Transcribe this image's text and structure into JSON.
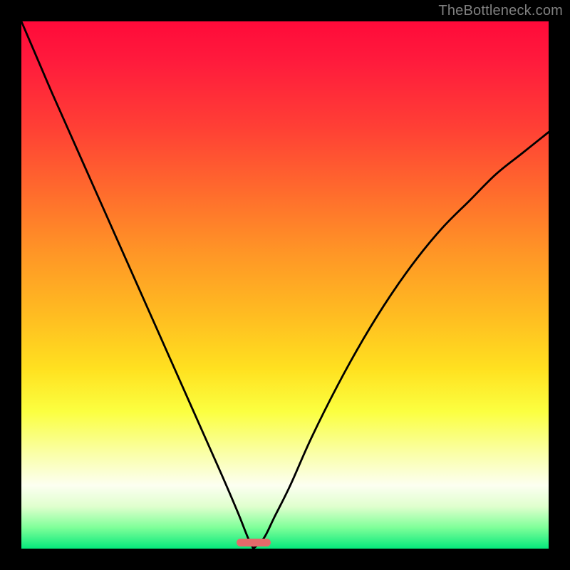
{
  "watermark": "TheBottleneck.com",
  "plot": {
    "background_gradient": {
      "stops": [
        {
          "pos": 0.0,
          "color": "#ff0a3a"
        },
        {
          "pos": 0.08,
          "color": "#ff1c3c"
        },
        {
          "pos": 0.2,
          "color": "#ff3f35"
        },
        {
          "pos": 0.32,
          "color": "#ff6a2d"
        },
        {
          "pos": 0.44,
          "color": "#ff9626"
        },
        {
          "pos": 0.56,
          "color": "#ffbd21"
        },
        {
          "pos": 0.66,
          "color": "#ffe120"
        },
        {
          "pos": 0.74,
          "color": "#fbff40"
        },
        {
          "pos": 0.82,
          "color": "#faffa8"
        },
        {
          "pos": 0.88,
          "color": "#fcfff1"
        },
        {
          "pos": 0.92,
          "color": "#e0ffce"
        },
        {
          "pos": 0.96,
          "color": "#7fff99"
        },
        {
          "pos": 1.0,
          "color": "#06e87c"
        }
      ]
    },
    "marker": {
      "x_fraction": 0.44,
      "y_fraction": 0.988,
      "width_fraction": 0.065,
      "color": "#e46a6a"
    }
  },
  "chart_data": {
    "type": "line",
    "title": "",
    "xlabel": "",
    "ylabel": "",
    "xlim": [
      0,
      100
    ],
    "ylim": [
      0,
      100
    ],
    "notes": "Two curves meeting near zero around x≈44; vertical gradient encodes bottleneck severity (red=high, green=low).",
    "cusp_x": 44,
    "series": [
      {
        "name": "left-branch",
        "x": [
          0,
          3,
          6,
          10,
          14,
          18,
          22,
          26,
          30,
          34,
          38,
          41,
          43,
          44
        ],
        "values": [
          100,
          93,
          86,
          77,
          68,
          59,
          50,
          41,
          32,
          23,
          14,
          7,
          2,
          0
        ]
      },
      {
        "name": "right-branch",
        "x": [
          44,
          46,
          48,
          51,
          55,
          60,
          65,
          70,
          75,
          80,
          85,
          90,
          95,
          100
        ],
        "values": [
          0,
          2,
          6,
          12,
          21,
          31,
          40,
          48,
          55,
          61,
          66,
          71,
          75,
          79
        ]
      }
    ]
  }
}
